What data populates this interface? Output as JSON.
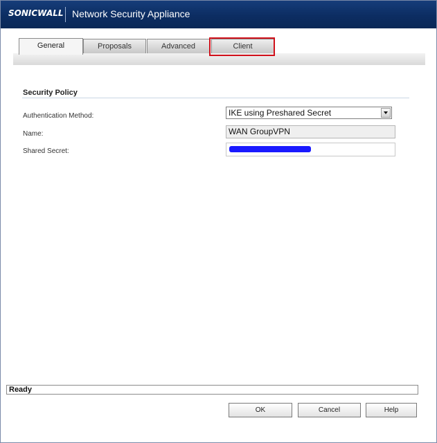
{
  "app": {
    "brand": "SONICWALL",
    "title": "Network Security Appliance"
  },
  "tabs": [
    {
      "label": "General",
      "active": true
    },
    {
      "label": "Proposals",
      "active": false
    },
    {
      "label": "Advanced",
      "active": false
    },
    {
      "label": "Client",
      "active": false
    }
  ],
  "section": {
    "title": "Security Policy"
  },
  "form": {
    "auth_method_label": "Authentication Method:",
    "auth_method_value": "IKE using Preshared Secret",
    "name_label": "Name:",
    "name_value": "WAN GroupVPN",
    "shared_secret_label": "Shared Secret:"
  },
  "status": {
    "text": "Ready"
  },
  "buttons": {
    "ok": "OK",
    "cancel": "Cancel",
    "help": "Help"
  },
  "colors": {
    "header": "#0c2d62",
    "highlight": "#d0101a",
    "redaction": "#1a1aff"
  }
}
